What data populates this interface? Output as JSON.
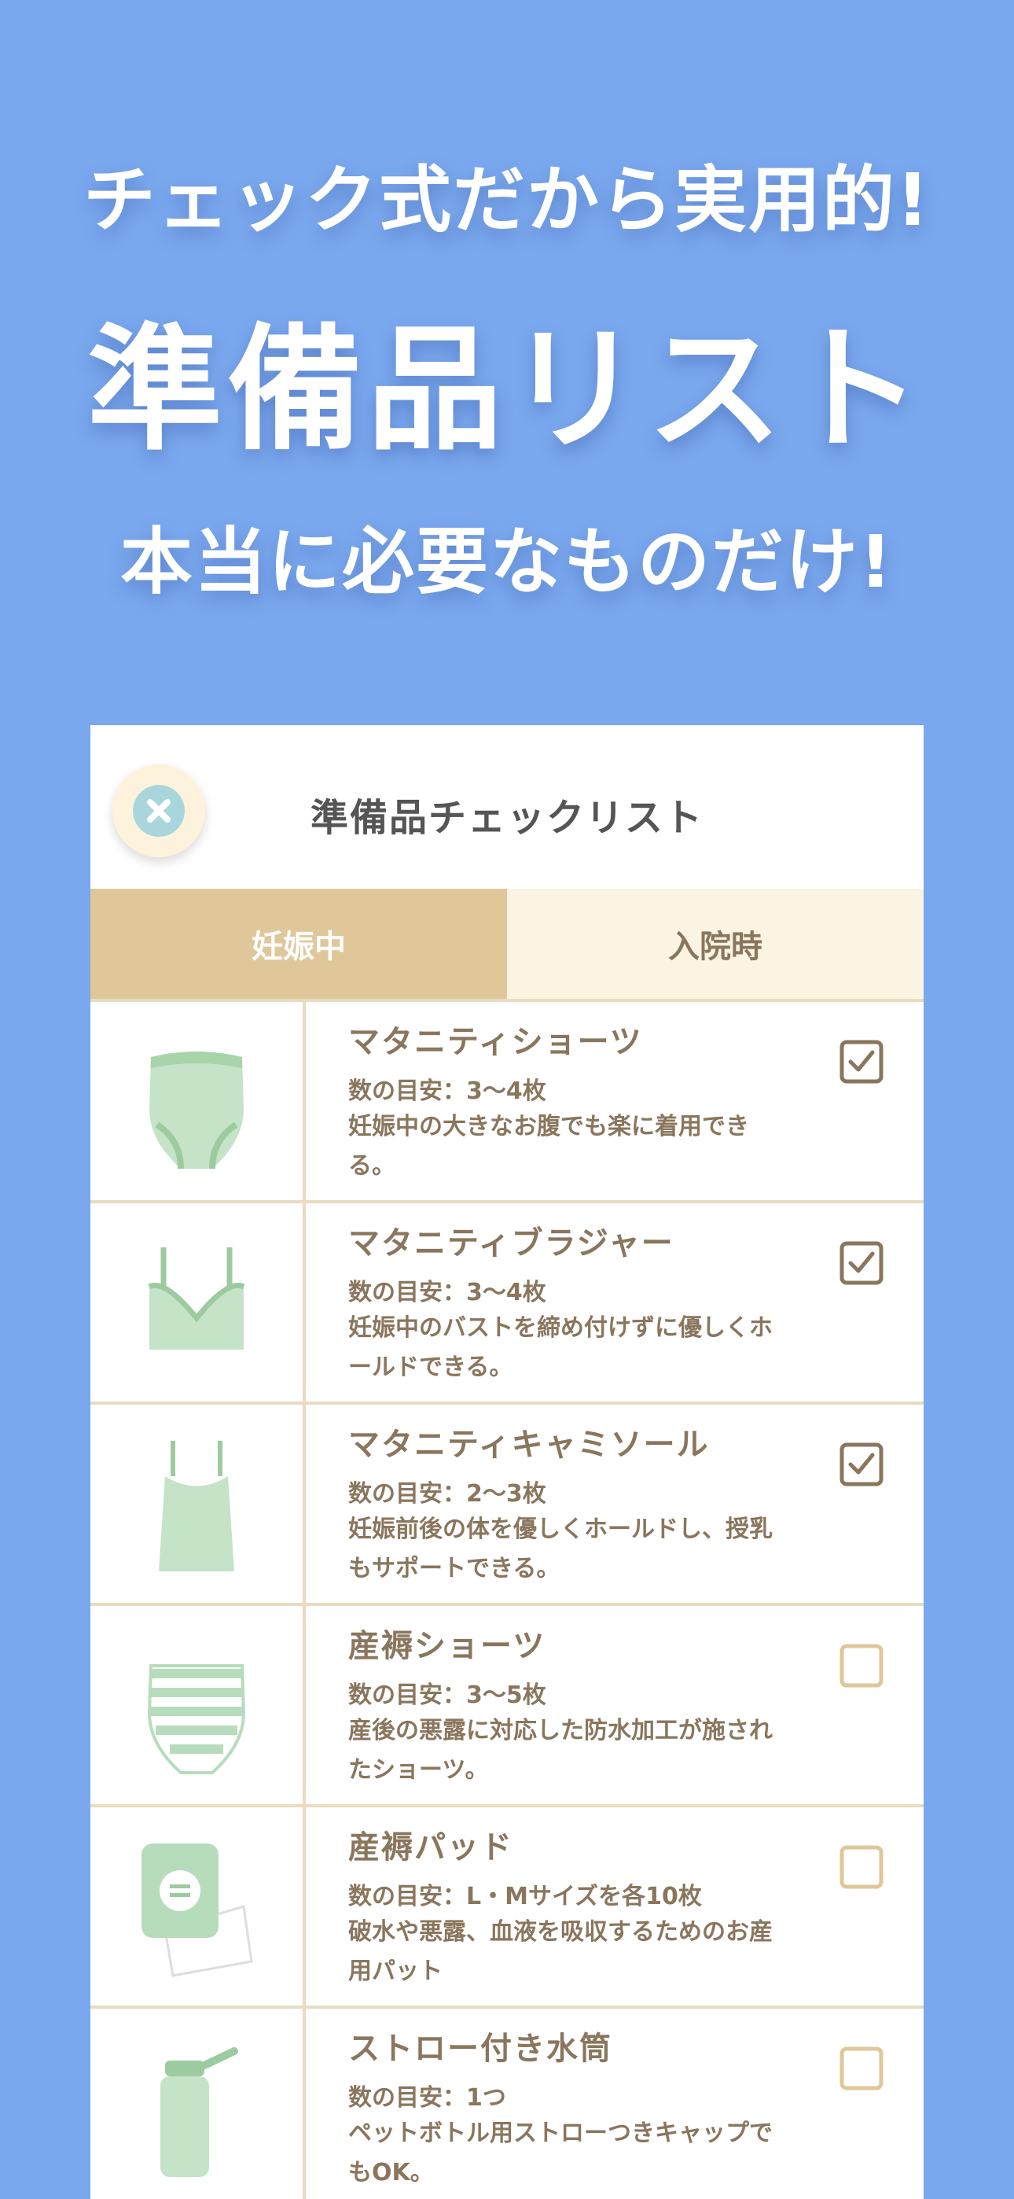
{
  "promo": {
    "line1": "チェック式だから実用的!",
    "line2": "準備品リスト",
    "line3": "本当に必要なものだけ!"
  },
  "card": {
    "title": "準備品チェックリスト",
    "close_icon": "close-icon",
    "tabs": [
      {
        "label": "妊娠中",
        "active": true
      },
      {
        "label": "入院時",
        "active": false
      }
    ],
    "items": [
      {
        "name": "マタニティショーツ",
        "qty": "数の目安：3〜4枚",
        "desc": "妊娠中の大きなお腹でも楽に着用できる。",
        "checked": true,
        "icon": "maternity-shorts-icon"
      },
      {
        "name": "マタニティブラジャー",
        "qty": "数の目安：3〜4枚",
        "desc": "妊娠中のバストを締め付けずに優しくホールドできる。",
        "checked": true,
        "icon": "maternity-bra-icon"
      },
      {
        "name": "マタニティキャミソール",
        "qty": "数の目安：2〜3枚",
        "desc": "妊娠前後の体を優しくホールドし、授乳もサポートできる。",
        "checked": true,
        "icon": "camisole-icon"
      },
      {
        "name": "産褥ショーツ",
        "qty": "数の目安：3〜5枚",
        "desc": "産後の悪露に対応した防水加工が施されたショーツ。",
        "checked": false,
        "icon": "postpartum-shorts-icon"
      },
      {
        "name": "産褥パッド",
        "qty": "数の目安：L・Mサイズを各10枚",
        "desc": "破水や悪露、血液を吸収するためのお産用パット",
        "checked": false,
        "icon": "postpartum-pad-icon"
      },
      {
        "name": "ストロー付き水筒",
        "qty": "数の目安：1つ",
        "desc": "ペットボトル用ストローつきキャップでもOK。",
        "checked": false,
        "icon": "water-bottle-icon"
      }
    ]
  },
  "colors": {
    "background": "#7aa8ee",
    "tab_active": "#dfc79a",
    "tab_inactive": "#fcf4e3",
    "text_brown": "#8a765d",
    "check_checked": "#8a765d",
    "check_unchecked": "#dfc79a",
    "item_green": "#b7dcbc"
  }
}
